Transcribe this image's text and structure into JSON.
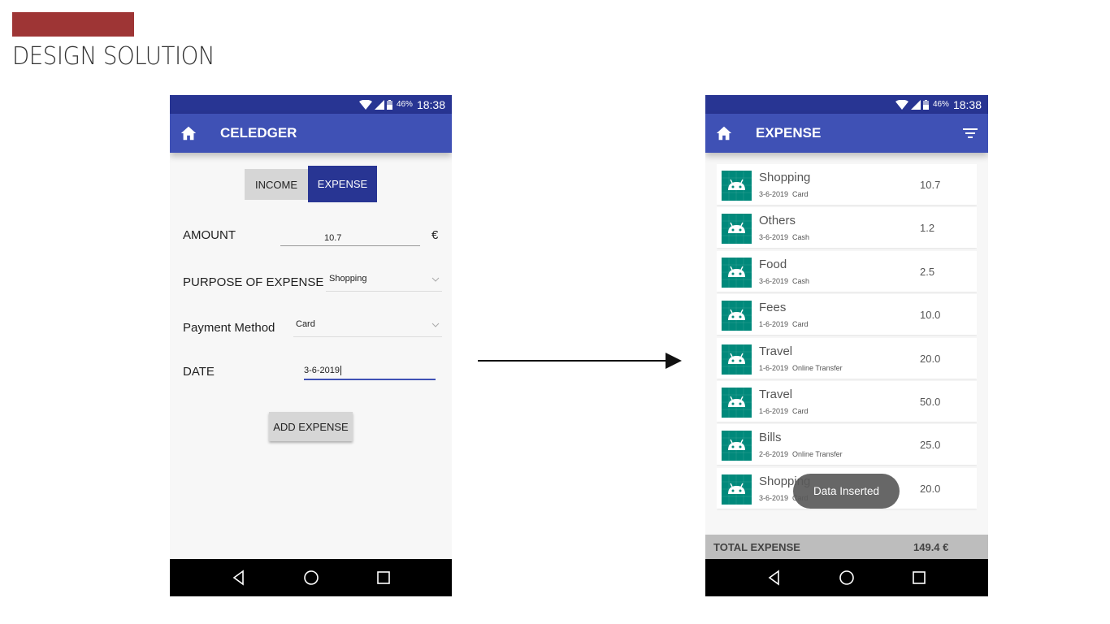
{
  "slide": {
    "title": "DESIGN SOLUTION",
    "accent_color": "#9e3535"
  },
  "status_bar": {
    "battery": "46%",
    "time": "18:38"
  },
  "left_screen": {
    "app_title": "CELEDGER",
    "toggle": {
      "income_label": "INCOME",
      "expense_label": "EXPENSE",
      "selected": "EXPENSE"
    },
    "amount": {
      "label": "AMOUNT",
      "value": "10.7",
      "currency": "€"
    },
    "purpose": {
      "label": "PURPOSE OF EXPENSE",
      "value": "Shopping"
    },
    "payment": {
      "label": "Payment Method",
      "value": "Card"
    },
    "date": {
      "label": "DATE",
      "value": "3-6-2019"
    },
    "add_button": "ADD EXPENSE"
  },
  "right_screen": {
    "app_title": "EXPENSE",
    "items": [
      {
        "title": "Shopping",
        "date": "3-6-2019",
        "method": "Card",
        "amount": "10.7"
      },
      {
        "title": "Others",
        "date": "3-6-2019",
        "method": "Cash",
        "amount": "1.2"
      },
      {
        "title": "Food",
        "date": "3-6-2019",
        "method": "Cash",
        "amount": "2.5"
      },
      {
        "title": "Fees",
        "date": "1-6-2019",
        "method": "Card",
        "amount": "10.0"
      },
      {
        "title": "Travel",
        "date": "1-6-2019",
        "method": "Online Transfer",
        "amount": "20.0"
      },
      {
        "title": "Travel",
        "date": "1-6-2019",
        "method": "Card",
        "amount": "50.0"
      },
      {
        "title": "Bills",
        "date": "2-6-2019",
        "method": "Online Transfer",
        "amount": "25.0"
      },
      {
        "title": "Shopping",
        "date": "3-6-2019",
        "method": "Card",
        "amount": "20.0"
      }
    ],
    "toast": "Data Inserted",
    "total_label": "TOTAL EXPENSE",
    "total_value": "149.4 €"
  },
  "colors": {
    "status_bar": "#283593",
    "app_bar": "#3f51b5",
    "expense_selected": "#283593",
    "icon_teal": "#00897b"
  }
}
